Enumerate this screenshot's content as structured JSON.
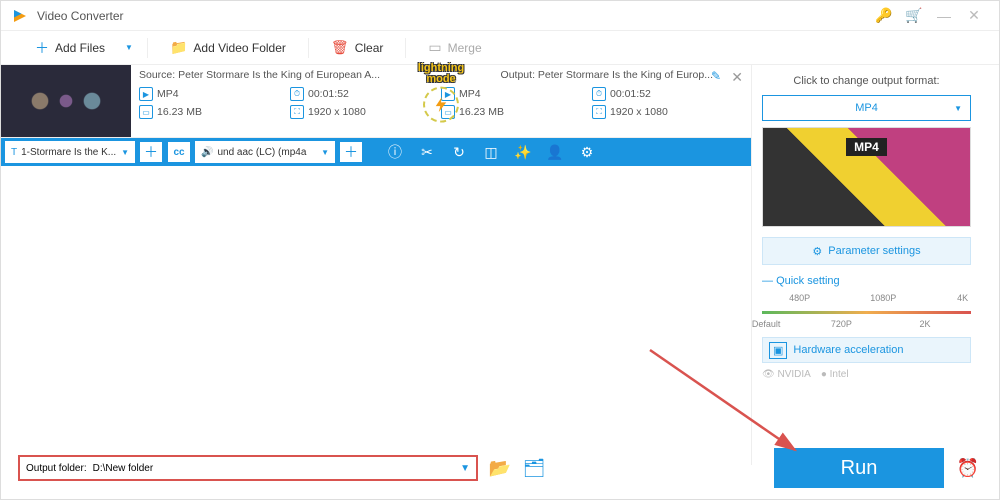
{
  "app": {
    "title": "Video Converter"
  },
  "toolbar": {
    "add_files": "Add Files",
    "add_folder": "Add Video Folder",
    "clear": "Clear",
    "merge": "Merge"
  },
  "item": {
    "source_label": "Source: Peter Stormare Is the King of European A...",
    "output_label": "Output: Peter Stormare Is the King of Europ...",
    "src": {
      "format": "MP4",
      "duration": "00:01:52",
      "size": "16.23 MB",
      "res": "1920 x 1080"
    },
    "out": {
      "format": "MP4",
      "duration": "00:01:52",
      "size": "16.23 MB",
      "res": "1920 x 1080"
    },
    "overlay": "lightning\nmode"
  },
  "subbar": {
    "track": "1-Stormare Is the K...",
    "audio": "und aac (LC) (mp4a"
  },
  "right": {
    "change_label": "Click to change output format:",
    "format": "MP4",
    "param_settings": "Parameter settings",
    "quick_setting": "Quick setting",
    "ticks_top": [
      "480P",
      "1080P",
      "4K"
    ],
    "ticks_bottom": [
      "Default",
      "720P",
      "2K"
    ],
    "hw_accel": "Hardware acceleration",
    "chips": [
      "NVIDIA",
      "Intel"
    ]
  },
  "footer": {
    "output_folder_label": "Output folder:",
    "output_folder_value": "D:\\New folder",
    "run": "Run"
  }
}
